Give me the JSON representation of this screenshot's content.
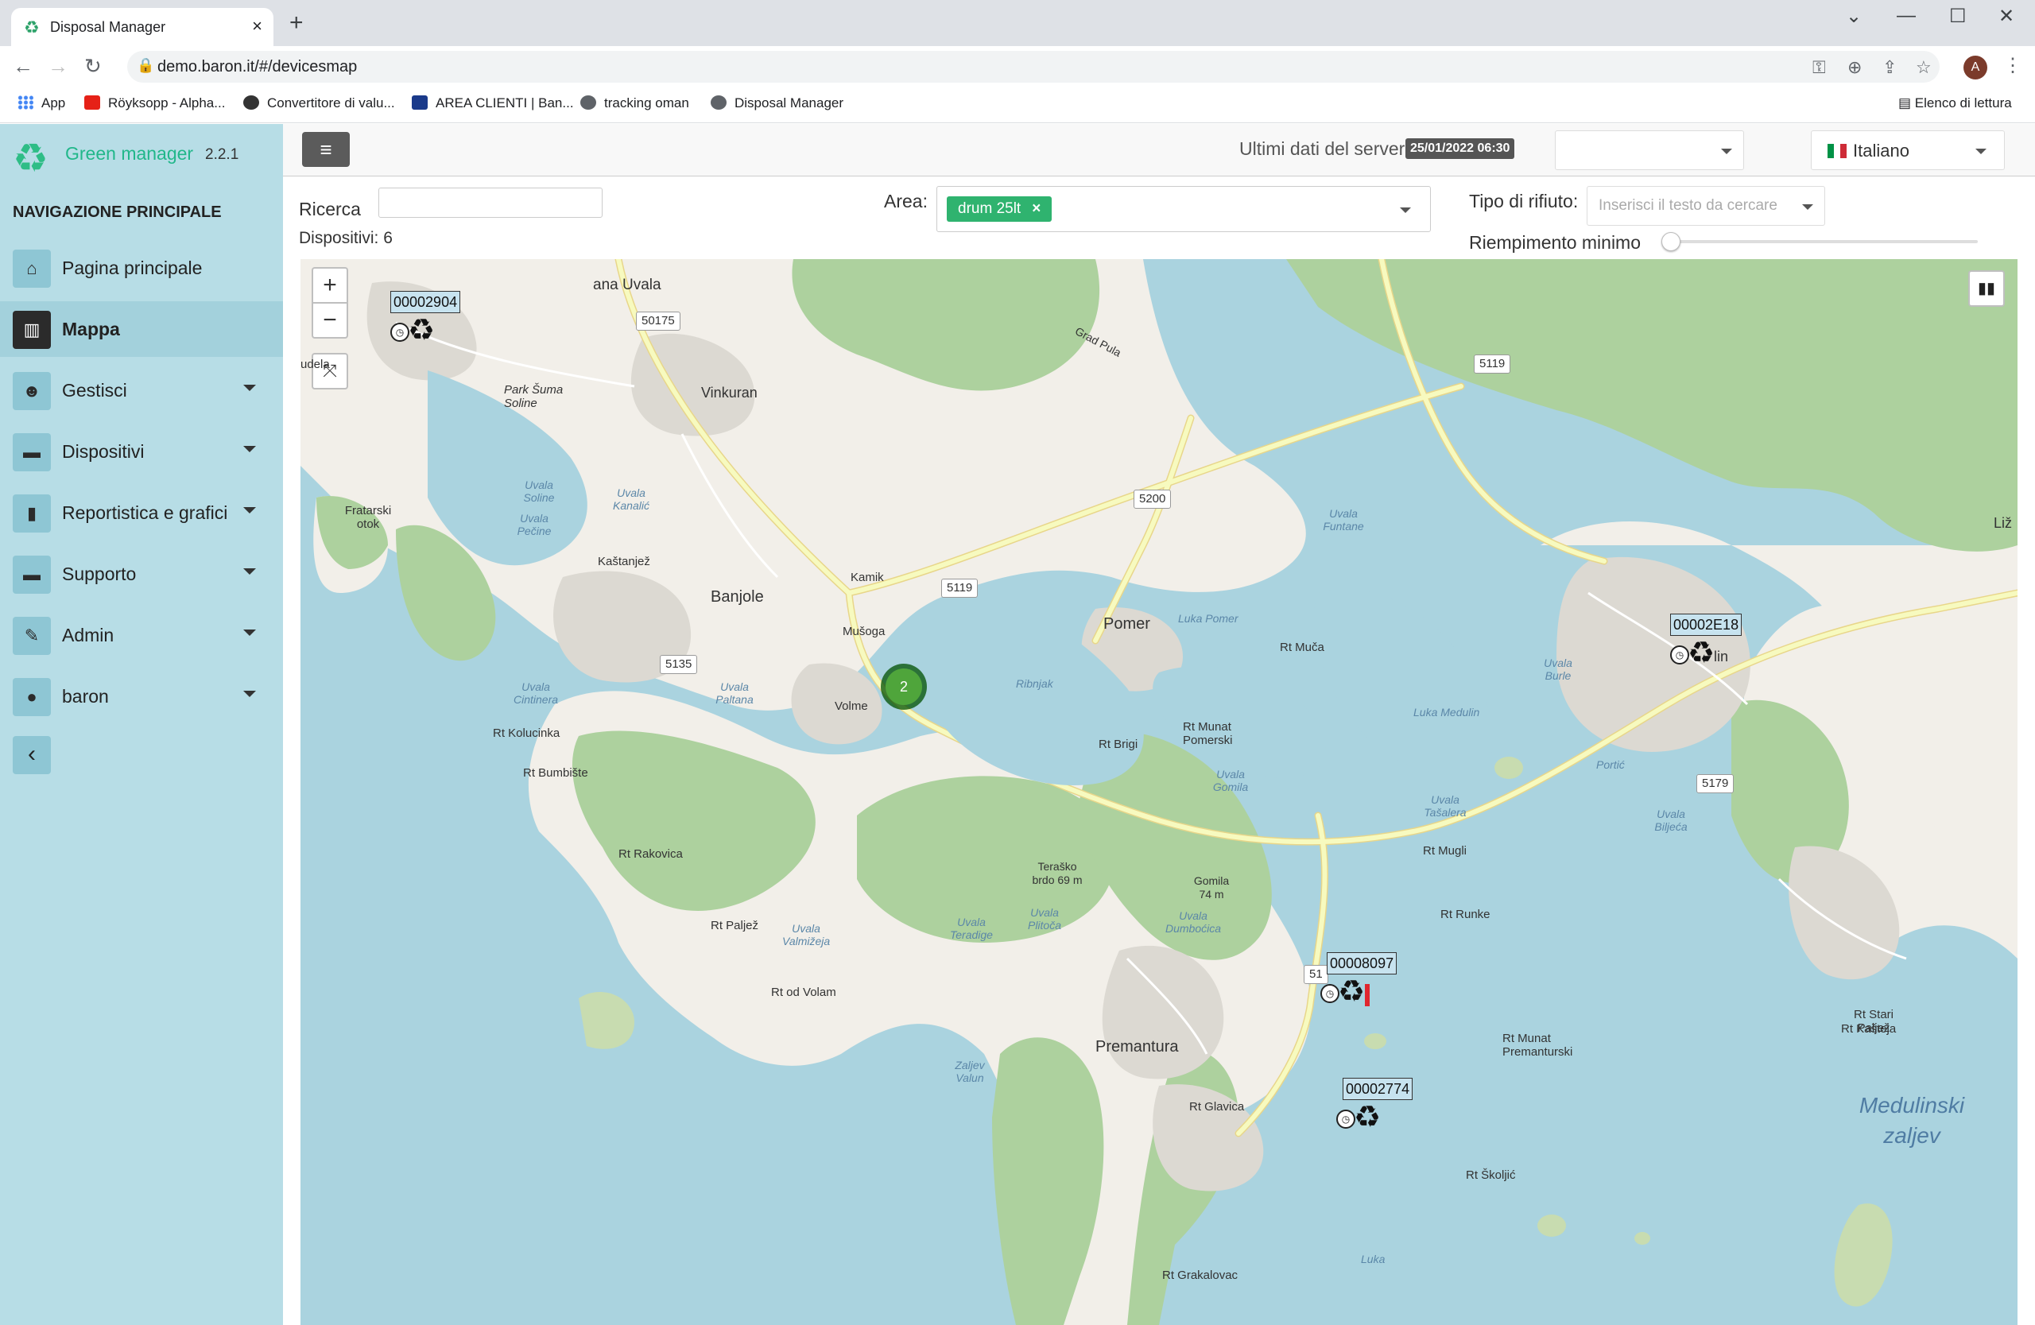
{
  "browser": {
    "tab_title": "Disposal Manager",
    "url": "demo.baron.it/#/devicesmap",
    "avatar_letter": "A",
    "bookmarks": [
      {
        "label": "App",
        "color": "#4285f4"
      },
      {
        "label": "Röyksopp - Alpha...",
        "color": "#e62117"
      },
      {
        "label": "Convertitore di valu...",
        "color": "#333333"
      },
      {
        "label": "AREA CLIENTI | Ban...",
        "color": "#1a3a8a"
      },
      {
        "label": "tracking oman",
        "color": "#5f6368"
      },
      {
        "label": "Disposal Manager",
        "color": "#5f6368"
      }
    ],
    "reading_list": "Elenco di lettura"
  },
  "brand": {
    "name": "Green manager",
    "version": "2.2.1",
    "color": "#21b78a"
  },
  "sidebar": {
    "title": "NAVIGAZIONE PRINCIPALE",
    "items": [
      {
        "label": "Pagina principale",
        "icon": "home-icon",
        "glyph": "⌂",
        "active": false,
        "dropdown": false
      },
      {
        "label": "Mappa",
        "icon": "map-icon",
        "glyph": "▥",
        "active": true,
        "dropdown": false
      },
      {
        "label": "Gestisci",
        "icon": "users-icon",
        "glyph": "👥",
        "active": false,
        "dropdown": true
      },
      {
        "label": "Dispositivi",
        "icon": "archive-icon",
        "glyph": "▬",
        "active": false,
        "dropdown": true
      },
      {
        "label": "Reportistica e grafici",
        "icon": "bar-chart-icon",
        "glyph": "▮",
        "active": false,
        "dropdown": true
      },
      {
        "label": "Supporto",
        "icon": "archive-icon",
        "glyph": "▬",
        "active": false,
        "dropdown": true
      },
      {
        "label": "Admin",
        "icon": "wrench-icon",
        "glyph": "✎",
        "active": false,
        "dropdown": true
      },
      {
        "label": "baron",
        "icon": "user-icon",
        "glyph": "●",
        "active": false,
        "dropdown": true
      }
    ]
  },
  "topbar": {
    "server_label": "Ultimi dati del server:",
    "server_date": "25/01/2022 06:30",
    "language": "Italiano"
  },
  "filters": {
    "search_label": "Ricerca",
    "search_value": "",
    "devices_label": "Dispositivi: 6",
    "area_label": "Area:",
    "area_tag": "drum 25lt",
    "area_tag_remove": "×",
    "tipo_label": "Tipo di rifiuto:",
    "tipo_placeholder": "Inserisci il testo da cercare",
    "fill_label": "Riempimento minimo",
    "fill_value": 0
  },
  "map": {
    "zoom_in": "+",
    "zoom_out": "−",
    "fullscreen": "⤧",
    "cluster_count": "2",
    "markers": [
      {
        "id": "00002904",
        "alert": false
      },
      {
        "id": "00002E18",
        "alert": false
      },
      {
        "id": "00008097",
        "alert": true
      },
      {
        "id": "00002774",
        "alert": false
      }
    ],
    "places": {
      "vinkuran": "Vinkuran",
      "banjole": "Banjole",
      "kastanjez": "Kaštanjež",
      "kamik": "Kamik",
      "musoga": "Mušoga",
      "volme": "Volme",
      "pomer": "Pomer",
      "premantura": "Premantura",
      "rt_kolucinka": "Rt Kolucinka",
      "rt_bumbiste": "Rt Bumbište",
      "rt_rakovica": "Rt Rakovica",
      "rt_paljez": "Rt Paljež",
      "rt_od_volam": "Rt od Volam",
      "rt_brigi": "Rt Brigi",
      "rt_munat_pomerski": "Rt Munat Pomerski",
      "rt_muca": "Rt Muča",
      "rt_mugli": "Rt Mugli",
      "rt_runke": "Rt Runke",
      "rt_munat_premanturski": "Rt Munat Premanturski",
      "rt_glavica": "Rt Glavica",
      "rt_skoljic": "Rt Školjić",
      "rt_grakalovac": "Rt Grakalovac",
      "rt_kasteja": "Rt Kašteja",
      "rt_stari_paljez": "Rt Stari Paljež",
      "fratarski_otok": "Fratarski otok",
      "park_suma_soline": "Park Šuma Soline",
      "terasko_brdo": "Teraško brdo 69 m",
      "gomila": "Gomila 74 m",
      "grad_pula": "Grad Pula",
      "medulinski_zaljev": "Medulinski zaljev",
      "luka_pomer": "Luka Pomer",
      "luka_medulin": "Luka Medulin",
      "ribnjak": "Ribnjak",
      "uvala_paltana": "Uvala Paltana",
      "uvala_cintinera": "Uvala Cintinera",
      "uvala_soline": "Uvala Soline",
      "uvala_pecine": "Uvala Pečine",
      "uvala_kanalic": "Uvala Kanalić",
      "uvala_funtane": "Uvala Funtane",
      "uvala_burle": "Uvala Burle",
      "uvala_valmizeja": "Uvala Valmižeja",
      "uvala_teradige": "Uvala Teradige",
      "uvala_plitoca": "Uvala Plitoča",
      "uvala_dumbocica": "Uvala Dumboćica",
      "uvala_gomila": "Uvala Gomila",
      "uvala_tasalera": "Uvala Tašalera",
      "zaljev_valun": "Zaljev Valun",
      "uvala_biljeca": "Uvala Biljeća",
      "luka": "Luka",
      "portic": "Portić",
      "liz": "Liž",
      "ana_uvala": "ana Uvala",
      "udela": "udela",
      "lin": "lin"
    },
    "roads": [
      "50175",
      "5119",
      "5200",
      "5119",
      "5135",
      "5119",
      "5179",
      "51"
    ]
  },
  "colors": {
    "sidebar_bg": "#b7dde6",
    "water": "#aad3df",
    "land": "#f2efe9",
    "forest": "#add19e",
    "road": "#f7fabf",
    "accent_green": "#2fb36f",
    "alert_red": "#e0262e"
  }
}
